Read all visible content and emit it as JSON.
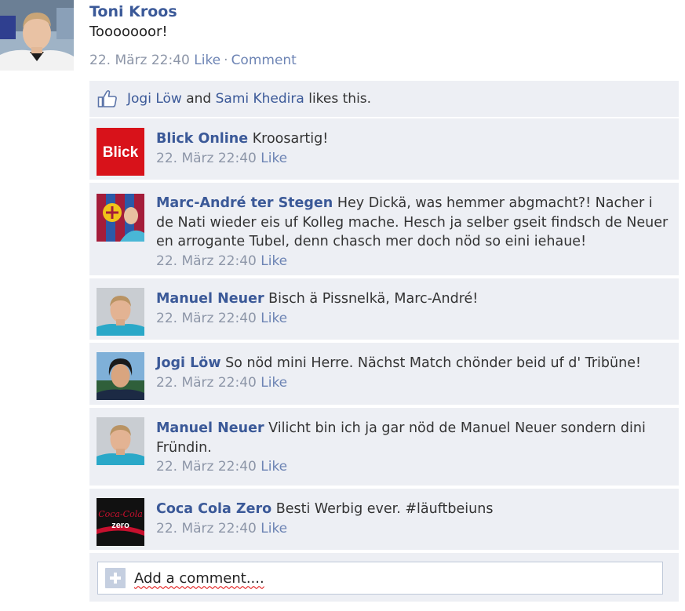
{
  "post": {
    "author": "Toni Kroos",
    "text": "Tooooooor!",
    "timestamp": "22. März 22:40",
    "like_label": "Like",
    "separator": "·",
    "comment_label": "Comment"
  },
  "likes": {
    "name1": "Jogi Löw",
    "and": "and",
    "name2": "Sami Khedira",
    "suffix": "likes this."
  },
  "comments": [
    {
      "author": "Blick Online",
      "text": "Kroosartig!",
      "timestamp": "22. März 22:40",
      "like_label": "Like",
      "avatar_text": "Blick"
    },
    {
      "author": "Marc-André ter Stegen",
      "text": "Hey Dickä, was hemmer abgmacht?! Nacher i de Nati wieder eis uf Kolleg mache. Hesch ja selber gseit findsch de Neuer en arrogante Tubel, denn chasch mer doch nöd so eini iehaue!",
      "timestamp": "22. März 22:40",
      "like_label": "Like"
    },
    {
      "author": "Manuel Neuer",
      "text": "Bisch ä Pissnelkä, Marc-André!",
      "timestamp": "22. März 22:40",
      "like_label": "Like"
    },
    {
      "author": "Jogi Löw",
      "text": "So nöd mini Herre. Nächst Match chönder beid uf d' Tribüne!",
      "timestamp": "22. März 22:40",
      "like_label": "Like"
    },
    {
      "author": "Manuel Neuer",
      "text": "Vilicht bin ich ja gar nöd de Manuel Neuer sondern dini Fründin.",
      "timestamp": "22. März 22:40",
      "like_label": "Like"
    },
    {
      "author": "Coca Cola Zero",
      "text": "Besti Werbig ever. #läuftbeiuns",
      "timestamp": "22. März 22:40",
      "like_label": "Like",
      "avatar_text_1": "Coca-Cola",
      "avatar_text_2": "zero"
    }
  ],
  "add_comment": {
    "placeholder": "Add a comment...."
  },
  "colors": {
    "link": "#3b5998",
    "meta": "#8d96a8",
    "panel": "#edeff4",
    "blick_red": "#d8121a"
  }
}
